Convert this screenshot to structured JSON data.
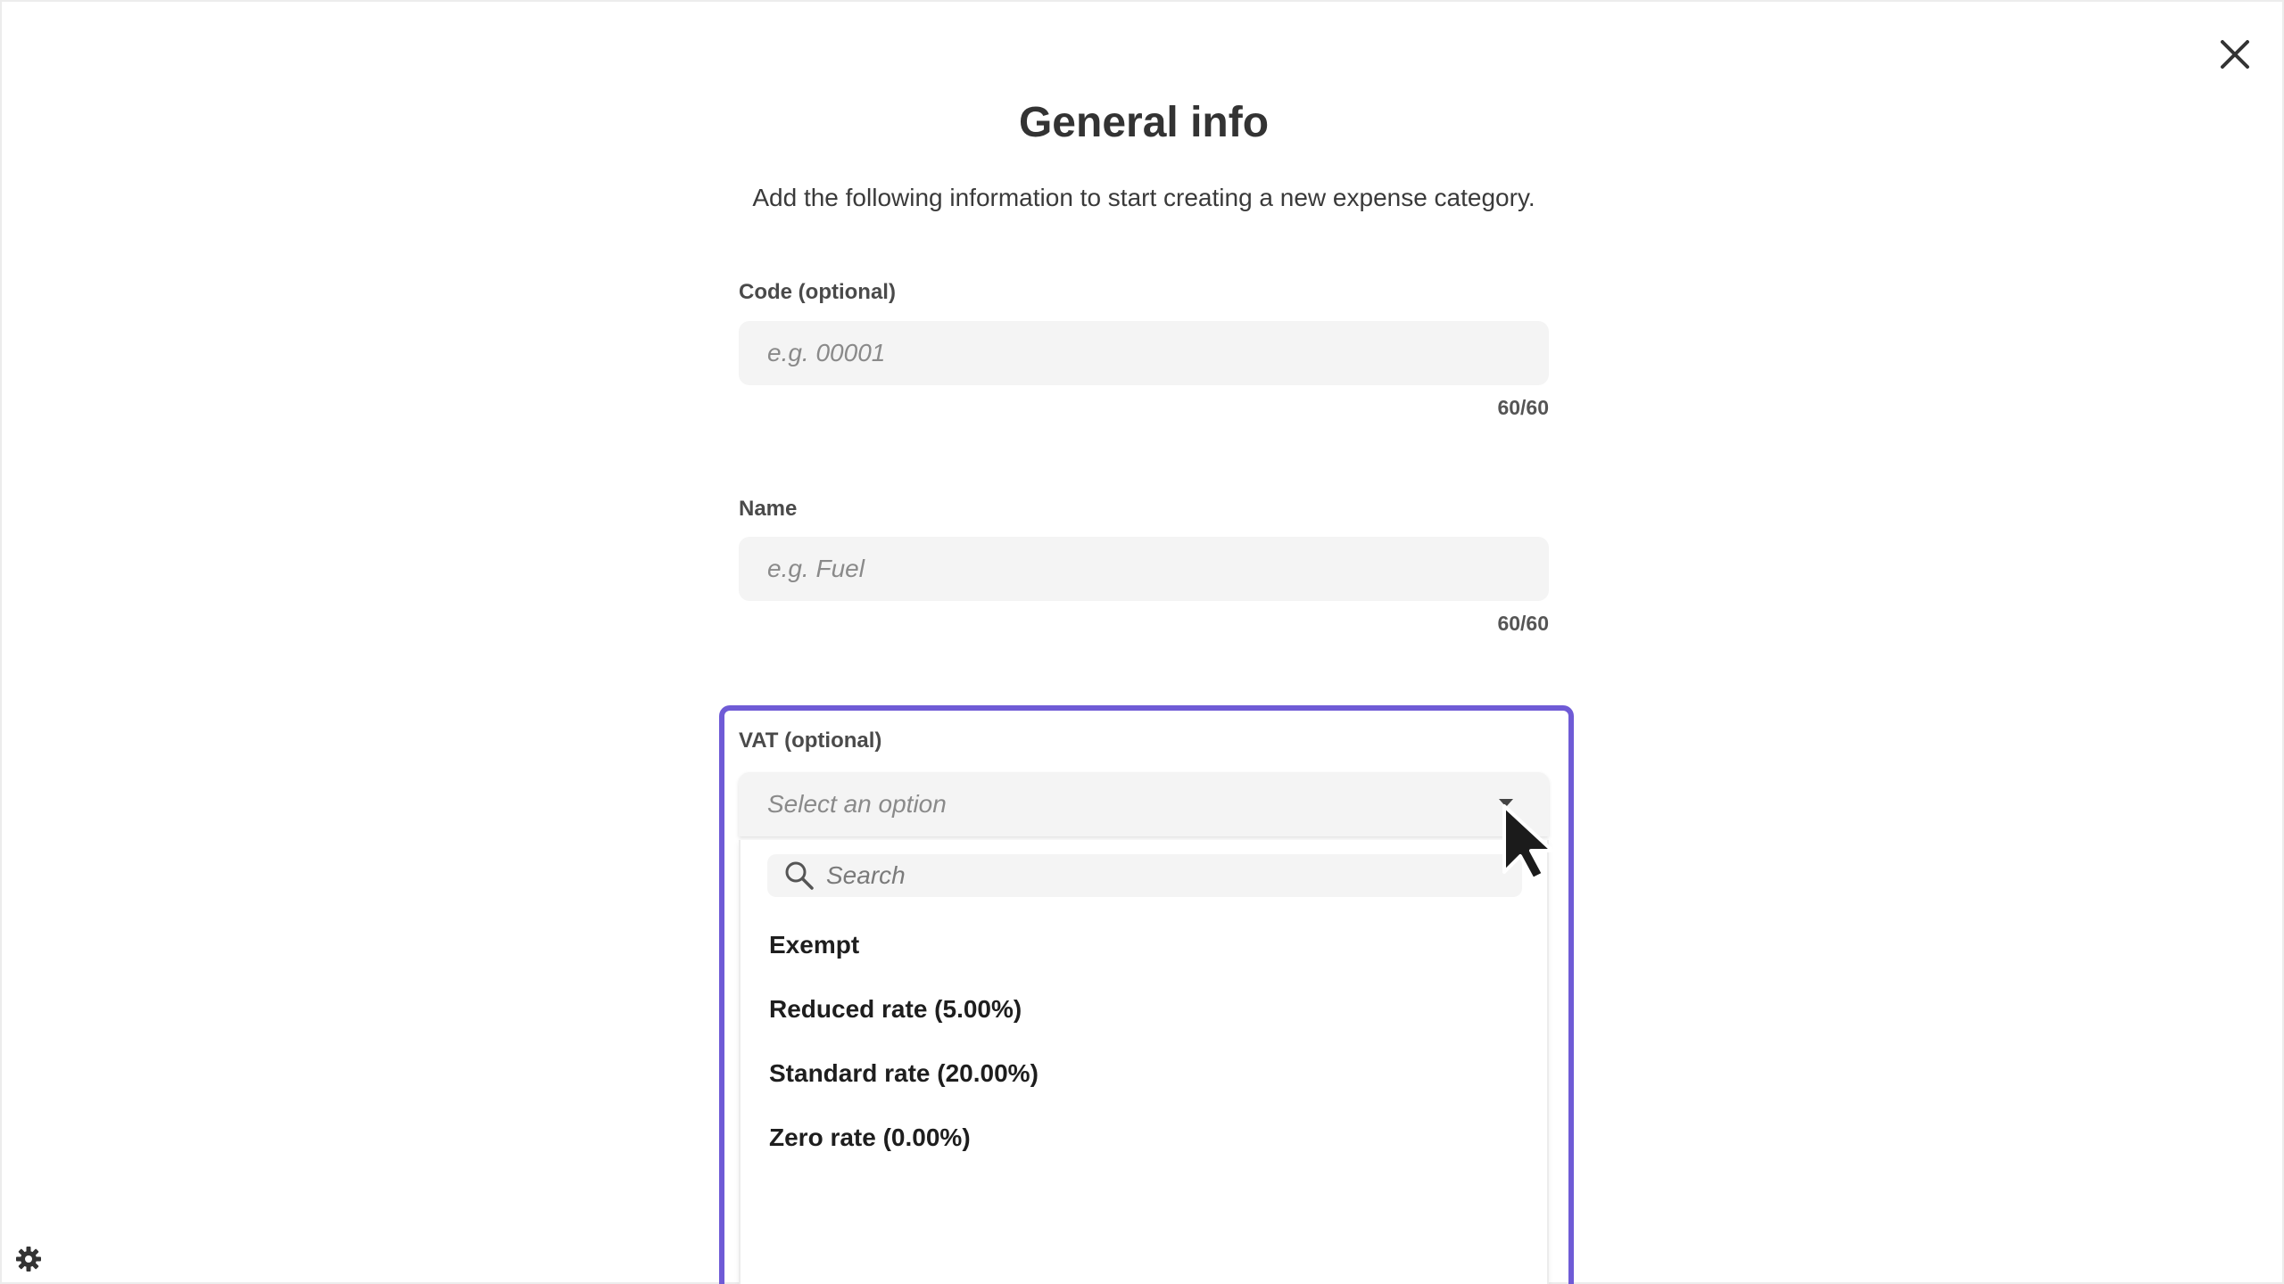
{
  "header": {
    "title": "General info",
    "subtitle": "Add the following information to start creating a new expense category."
  },
  "fields": {
    "code": {
      "label": "Code (optional)",
      "placeholder": "e.g. 00001",
      "value": "",
      "counter": "60/60"
    },
    "name": {
      "label": "Name",
      "placeholder": "e.g. Fuel",
      "value": "",
      "counter": "60/60"
    },
    "vat": {
      "label": "VAT (optional)",
      "placeholder": "Select an option",
      "search_placeholder": "Search",
      "options": [
        "Exempt",
        "Reduced rate (5.00%)",
        "Standard rate (20.00%)",
        "Zero rate (0.00%)"
      ],
      "expanded": true
    }
  },
  "colors": {
    "highlight": "#6f5bd6",
    "input_bg": "#f4f4f4",
    "title_text": "#333333"
  },
  "icons": {
    "close": "close-icon",
    "settings": "gear-icon",
    "search": "search-icon",
    "dropdown": "chevron-down-icon",
    "cursor": "mouse-pointer-icon"
  }
}
